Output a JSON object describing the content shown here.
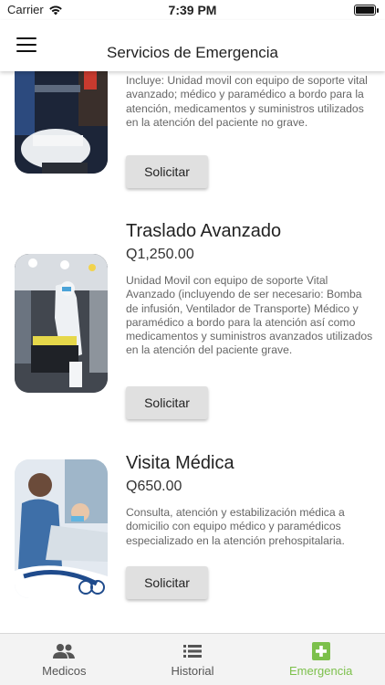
{
  "status_bar": {
    "carrier": "Carrier",
    "time": "7:39 PM"
  },
  "app_bar": {
    "title": "Servicios de Emergencia"
  },
  "services": [
    {
      "title": "",
      "price": "",
      "description": "Incluye: Unidad movil con equipo de soporte vital avanzado; médico y paramédico a bordo para la atención, medicamentos y suministros utilizados en la atención del paciente no grave.",
      "button": "Solicitar"
    },
    {
      "title": "Traslado Avanzado",
      "price": "Q1,250.00",
      "description": "Unidad Movil con equipo de soporte Vital Avanzado (incluyendo de ser necesario: Bomba de infusión, Ventilador de Transporte) Médico y paramédico a bordo para la atención así como medicamentos y suministros avanzados utilizados en la atención del paciente grave.",
      "button": "Solicitar"
    },
    {
      "title": "Visita Médica",
      "price": "Q650.00",
      "description": "Consulta, atención y estabilización médica a domicilio con equipo médico y paramédicos especializado en la atención prehospitalaria.",
      "button": "Solicitar"
    }
  ],
  "tab_bar": {
    "tabs": [
      {
        "label": "Medicos",
        "icon": "people-icon"
      },
      {
        "label": "Historial",
        "icon": "list-icon"
      },
      {
        "label": "Emergencia",
        "icon": "medical-cross-icon"
      }
    ],
    "active": "Emergencia",
    "active_color": "#7cc04b"
  }
}
